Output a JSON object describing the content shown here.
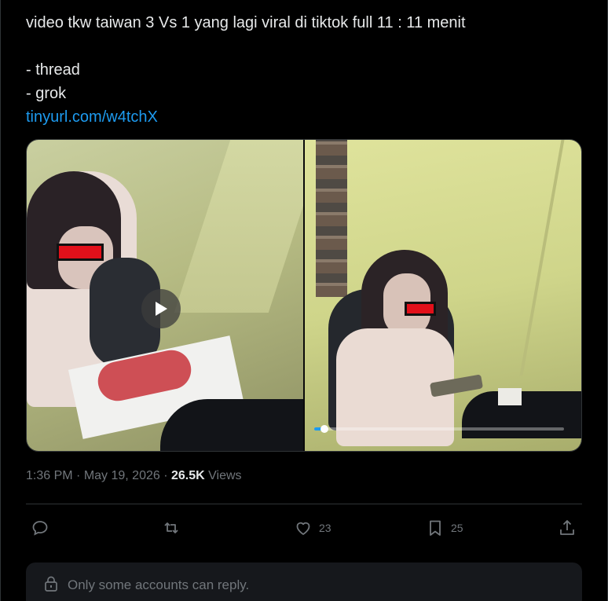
{
  "tweet": {
    "lines": [
      "video tkw taiwan 3 Vs 1 yang lagi viral di tiktok full 11 : 11 menit",
      "",
      "- thread",
      "- grok"
    ],
    "link": "tinyurl.com/w4tchX"
  },
  "media": {
    "video_progress": 0.04
  },
  "meta": {
    "time": "1:36 PM",
    "dot1": " · ",
    "date": "May 19, 2026",
    "dot2": " · ",
    "views_count": "26.5K",
    "views_label": " Views"
  },
  "actions": {
    "like_count": "23",
    "bookmark_count": "25"
  },
  "reply_restriction": {
    "text": "Only some accounts can reply."
  },
  "colors": {
    "link": "#1d9bf0",
    "muted": "#71767b",
    "background": "#000000",
    "redaction": "#e2101a"
  }
}
